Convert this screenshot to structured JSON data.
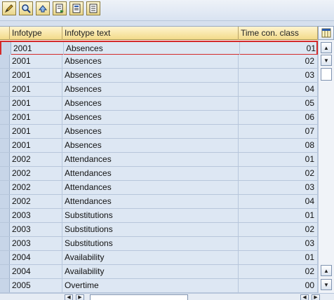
{
  "toolbar": {
    "buttons": [
      {
        "name": "change-icon"
      },
      {
        "name": "details-icon"
      },
      {
        "name": "refresh-icon"
      },
      {
        "name": "export-icon"
      },
      {
        "name": "print-icon"
      },
      {
        "name": "list-icon"
      }
    ]
  },
  "table": {
    "headers": [
      "Infotype",
      "Infotype text",
      "Time con. class"
    ],
    "rows": [
      {
        "infotype": "2001",
        "text": "Absences",
        "class": "01"
      },
      {
        "infotype": "2001",
        "text": "Absences",
        "class": "02"
      },
      {
        "infotype": "2001",
        "text": "Absences",
        "class": "03"
      },
      {
        "infotype": "2001",
        "text": "Absences",
        "class": "04"
      },
      {
        "infotype": "2001",
        "text": "Absences",
        "class": "05"
      },
      {
        "infotype": "2001",
        "text": "Absences",
        "class": "06"
      },
      {
        "infotype": "2001",
        "text": "Absences",
        "class": "07"
      },
      {
        "infotype": "2001",
        "text": "Absences",
        "class": "08"
      },
      {
        "infotype": "2002",
        "text": "Attendances",
        "class": "01"
      },
      {
        "infotype": "2002",
        "text": "Attendances",
        "class": "02"
      },
      {
        "infotype": "2002",
        "text": "Attendances",
        "class": "03"
      },
      {
        "infotype": "2002",
        "text": "Attendances",
        "class": "04"
      },
      {
        "infotype": "2003",
        "text": "Substitutions",
        "class": "01"
      },
      {
        "infotype": "2003",
        "text": "Substitutions",
        "class": "02"
      },
      {
        "infotype": "2003",
        "text": "Substitutions",
        "class": "03"
      },
      {
        "infotype": "2004",
        "text": "Availability",
        "class": "01"
      },
      {
        "infotype": "2004",
        "text": "Availability",
        "class": "02"
      },
      {
        "infotype": "2005",
        "text": "Overtime",
        "class": "00"
      }
    ],
    "selected_row": 0
  },
  "colors": {
    "header_bg": "#f3db8a",
    "row_bg": "#dde7f3",
    "selection_border": "#d42a2a"
  }
}
